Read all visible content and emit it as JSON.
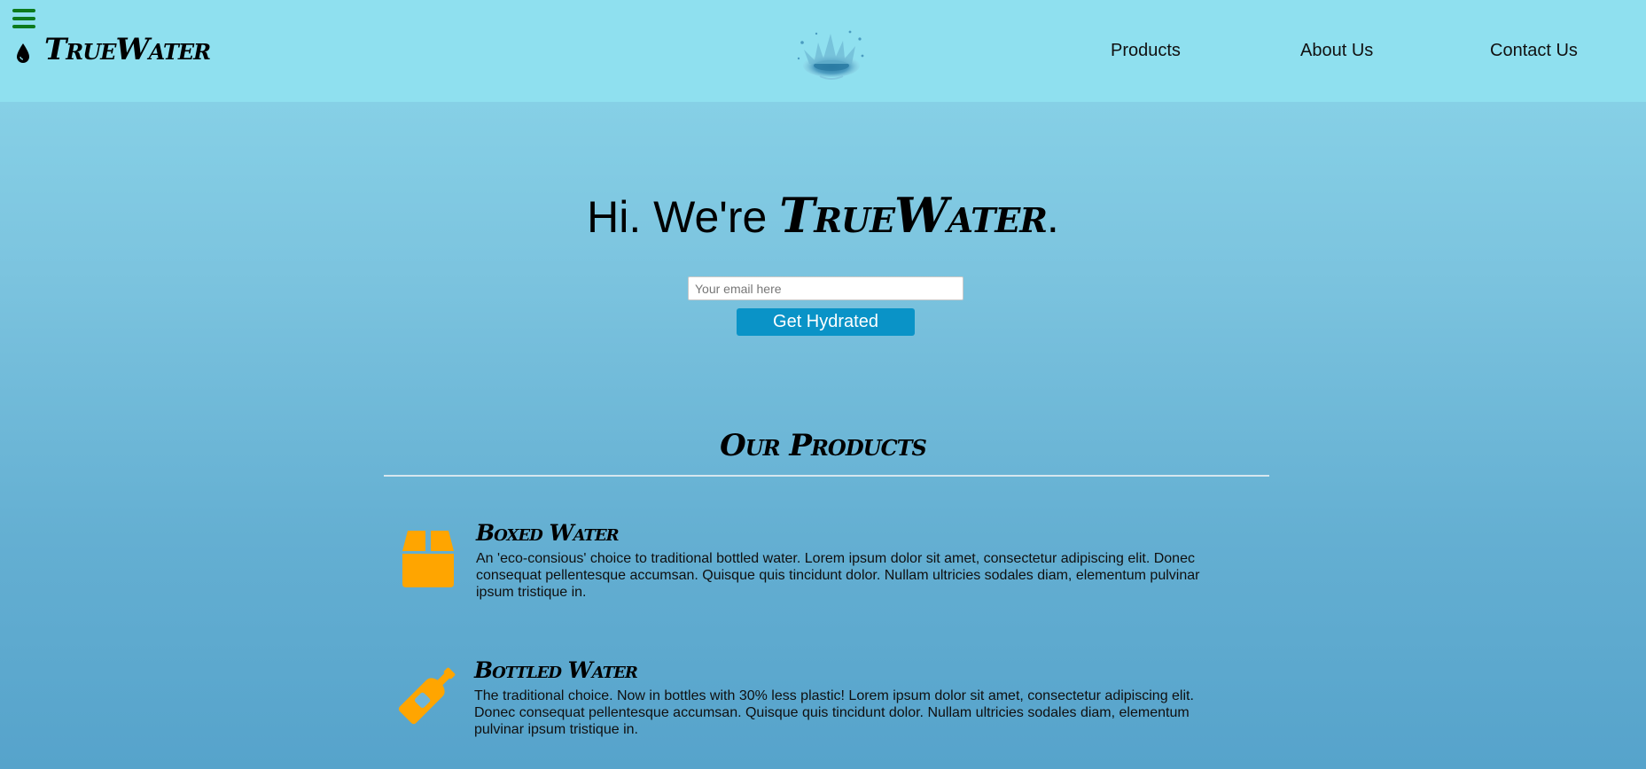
{
  "header": {
    "menu_icon": "hamburger-menu-icon",
    "drop_icon": "water-drop-icon",
    "logo_text": "TrueWater",
    "splash_image": "water-splash-logo",
    "nav": [
      {
        "label": "Products"
      },
      {
        "label": "About Us"
      },
      {
        "label": "Contact Us"
      }
    ]
  },
  "hero": {
    "title_prefix": "Hi. We're ",
    "title_brand": "TrueWater",
    "title_suffix": ".",
    "email_placeholder": "Your email here",
    "email_value": "",
    "cta_label": "Get Hydrated"
  },
  "products": {
    "heading": "Our Products",
    "items": [
      {
        "icon": "box-icon",
        "name": "Boxed Water",
        "description": "An 'eco-consious' choice to traditional bottled water. Lorem ipsum dolor sit amet, consectetur adipiscing elit. Donec consequat pellentesque accumsan. Quisque quis tincidunt dolor. Nullam ultricies sodales diam, elementum pulvinar ipsum tristique in."
      },
      {
        "icon": "bottle-icon",
        "name": "Bottled Water",
        "description": "The traditional choice. Now in bottles with 30% less plastic! Lorem ipsum dolor sit amet, consectetur adipiscing elit. Donec consequat pellentesque accumsan. Quisque quis tincidunt dolor. Nullam ultricies sodales diam, elementum pulvinar ipsum tristique in."
      }
    ]
  },
  "colors": {
    "header_bg": "#8fe0ef",
    "menu_icon": "#0c7a1c",
    "cta_bg": "#0a93c7",
    "product_icon": "#ffa500"
  }
}
